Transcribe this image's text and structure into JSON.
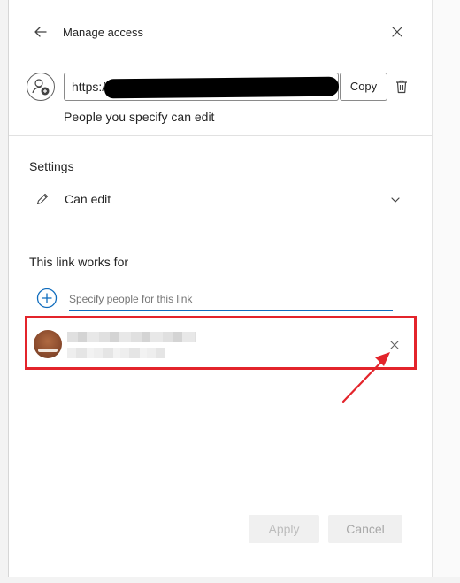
{
  "header": {
    "title": "Manage access",
    "back_icon": "arrow-left-icon",
    "close_icon": "close-icon"
  },
  "link": {
    "url_value": "https:/",
    "copy_label": "Copy",
    "description": "People you specify can edit",
    "link_icon": "share-link-icon",
    "delete_icon": "trash-icon"
  },
  "settings": {
    "heading": "Settings",
    "permission_value": "Can edit",
    "permission_icon": "pencil-icon"
  },
  "audience": {
    "heading": "This link works for",
    "add_icon": "add-circle-icon",
    "people_placeholder": "Specify people for this link",
    "people": [
      {
        "name": "",
        "email": "",
        "remove_icon": "close-icon"
      }
    ]
  },
  "footer": {
    "apply_label": "Apply",
    "cancel_label": "Cancel"
  },
  "colors": {
    "accent": "#0f6cbd",
    "highlight": "#e3242b",
    "disabled_bg": "#f0f0f0"
  }
}
